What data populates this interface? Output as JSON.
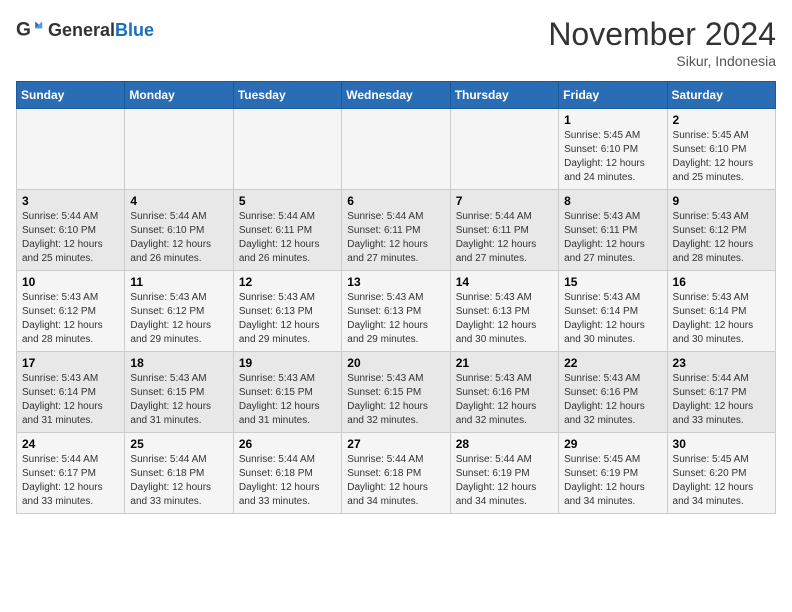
{
  "header": {
    "logo_general": "General",
    "logo_blue": "Blue",
    "month_title": "November 2024",
    "location": "Sikur, Indonesia"
  },
  "days_of_week": [
    "Sunday",
    "Monday",
    "Tuesday",
    "Wednesday",
    "Thursday",
    "Friday",
    "Saturday"
  ],
  "weeks": [
    [
      {
        "day": "",
        "info": ""
      },
      {
        "day": "",
        "info": ""
      },
      {
        "day": "",
        "info": ""
      },
      {
        "day": "",
        "info": ""
      },
      {
        "day": "",
        "info": ""
      },
      {
        "day": "1",
        "info": "Sunrise: 5:45 AM\nSunset: 6:10 PM\nDaylight: 12 hours and 24 minutes."
      },
      {
        "day": "2",
        "info": "Sunrise: 5:45 AM\nSunset: 6:10 PM\nDaylight: 12 hours and 25 minutes."
      }
    ],
    [
      {
        "day": "3",
        "info": "Sunrise: 5:44 AM\nSunset: 6:10 PM\nDaylight: 12 hours and 25 minutes."
      },
      {
        "day": "4",
        "info": "Sunrise: 5:44 AM\nSunset: 6:10 PM\nDaylight: 12 hours and 26 minutes."
      },
      {
        "day": "5",
        "info": "Sunrise: 5:44 AM\nSunset: 6:11 PM\nDaylight: 12 hours and 26 minutes."
      },
      {
        "day": "6",
        "info": "Sunrise: 5:44 AM\nSunset: 6:11 PM\nDaylight: 12 hours and 27 minutes."
      },
      {
        "day": "7",
        "info": "Sunrise: 5:44 AM\nSunset: 6:11 PM\nDaylight: 12 hours and 27 minutes."
      },
      {
        "day": "8",
        "info": "Sunrise: 5:43 AM\nSunset: 6:11 PM\nDaylight: 12 hours and 27 minutes."
      },
      {
        "day": "9",
        "info": "Sunrise: 5:43 AM\nSunset: 6:12 PM\nDaylight: 12 hours and 28 minutes."
      }
    ],
    [
      {
        "day": "10",
        "info": "Sunrise: 5:43 AM\nSunset: 6:12 PM\nDaylight: 12 hours and 28 minutes."
      },
      {
        "day": "11",
        "info": "Sunrise: 5:43 AM\nSunset: 6:12 PM\nDaylight: 12 hours and 29 minutes."
      },
      {
        "day": "12",
        "info": "Sunrise: 5:43 AM\nSunset: 6:13 PM\nDaylight: 12 hours and 29 minutes."
      },
      {
        "day": "13",
        "info": "Sunrise: 5:43 AM\nSunset: 6:13 PM\nDaylight: 12 hours and 29 minutes."
      },
      {
        "day": "14",
        "info": "Sunrise: 5:43 AM\nSunset: 6:13 PM\nDaylight: 12 hours and 30 minutes."
      },
      {
        "day": "15",
        "info": "Sunrise: 5:43 AM\nSunset: 6:14 PM\nDaylight: 12 hours and 30 minutes."
      },
      {
        "day": "16",
        "info": "Sunrise: 5:43 AM\nSunset: 6:14 PM\nDaylight: 12 hours and 30 minutes."
      }
    ],
    [
      {
        "day": "17",
        "info": "Sunrise: 5:43 AM\nSunset: 6:14 PM\nDaylight: 12 hours and 31 minutes."
      },
      {
        "day": "18",
        "info": "Sunrise: 5:43 AM\nSunset: 6:15 PM\nDaylight: 12 hours and 31 minutes."
      },
      {
        "day": "19",
        "info": "Sunrise: 5:43 AM\nSunset: 6:15 PM\nDaylight: 12 hours and 31 minutes."
      },
      {
        "day": "20",
        "info": "Sunrise: 5:43 AM\nSunset: 6:15 PM\nDaylight: 12 hours and 32 minutes."
      },
      {
        "day": "21",
        "info": "Sunrise: 5:43 AM\nSunset: 6:16 PM\nDaylight: 12 hours and 32 minutes."
      },
      {
        "day": "22",
        "info": "Sunrise: 5:43 AM\nSunset: 6:16 PM\nDaylight: 12 hours and 32 minutes."
      },
      {
        "day": "23",
        "info": "Sunrise: 5:44 AM\nSunset: 6:17 PM\nDaylight: 12 hours and 33 minutes."
      }
    ],
    [
      {
        "day": "24",
        "info": "Sunrise: 5:44 AM\nSunset: 6:17 PM\nDaylight: 12 hours and 33 minutes."
      },
      {
        "day": "25",
        "info": "Sunrise: 5:44 AM\nSunset: 6:18 PM\nDaylight: 12 hours and 33 minutes."
      },
      {
        "day": "26",
        "info": "Sunrise: 5:44 AM\nSunset: 6:18 PM\nDaylight: 12 hours and 33 minutes."
      },
      {
        "day": "27",
        "info": "Sunrise: 5:44 AM\nSunset: 6:18 PM\nDaylight: 12 hours and 34 minutes."
      },
      {
        "day": "28",
        "info": "Sunrise: 5:44 AM\nSunset: 6:19 PM\nDaylight: 12 hours and 34 minutes."
      },
      {
        "day": "29",
        "info": "Sunrise: 5:45 AM\nSunset: 6:19 PM\nDaylight: 12 hours and 34 minutes."
      },
      {
        "day": "30",
        "info": "Sunrise: 5:45 AM\nSunset: 6:20 PM\nDaylight: 12 hours and 34 minutes."
      }
    ]
  ]
}
